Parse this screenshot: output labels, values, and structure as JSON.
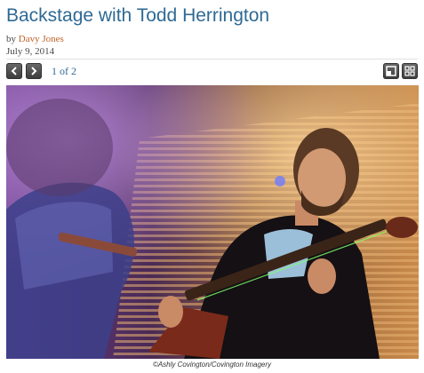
{
  "article": {
    "title": "Backstage with Todd Herrington",
    "byline_prefix": "by",
    "author": "Davy Jones",
    "date": "July 9, 2014"
  },
  "gallery": {
    "counter": "1 of 2",
    "prev_icon": "chevron-left-icon",
    "next_icon": "chevron-right-icon",
    "fullscreen_icon": "expand-icon",
    "thumbnails_icon": "grid-icon",
    "photo_credit": "©Ashly Covington/Covington Imagery"
  },
  "colors": {
    "title": "#2f6a94",
    "author_link": "#c0622a",
    "button": "#4a4a4a"
  }
}
